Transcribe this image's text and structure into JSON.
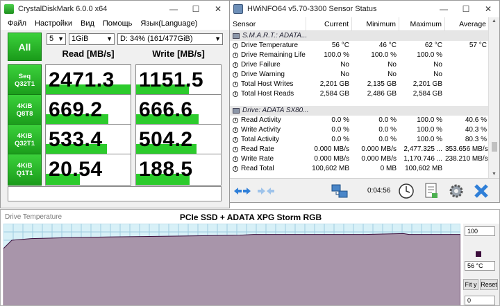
{
  "cdm": {
    "title": "CrystalDiskMark 6.0.0 x64",
    "menu": [
      "Файл",
      "Настройки",
      "Вид",
      "Помощь",
      "Язык(Language)"
    ],
    "all_label": "All",
    "count": "5",
    "size": "1GiB",
    "drive": "D: 34% (161/477GiB)",
    "read_header": "Read [MB/s]",
    "write_header": "Write [MB/s]",
    "rows": [
      {
        "line1": "Seq",
        "line2": "Q32T1",
        "read": "2471.3",
        "write": "1151.5",
        "read_fill": 1.0,
        "write_fill": 0.62
      },
      {
        "line1": "4KiB",
        "line2": "Q8T8",
        "read": "669.2",
        "write": "666.6",
        "read_fill": 0.74,
        "write_fill": 0.74
      },
      {
        "line1": "4KiB",
        "line2": "Q32T1",
        "read": "533.4",
        "write": "504.2",
        "read_fill": 0.72,
        "write_fill": 0.71
      },
      {
        "line1": "4KiB",
        "line2": "Q1T1",
        "read": "20.54",
        "write": "188.5",
        "read_fill": 0.4,
        "write_fill": 0.63
      }
    ]
  },
  "hw": {
    "title": "HWiNFO64 v5.70-3300 Sensor Status",
    "columns": [
      "Sensor",
      "Current",
      "Minimum",
      "Maximum",
      "Average"
    ],
    "groups": [
      {
        "name": "S.M.A.R.T.: ADATA...",
        "rows": [
          [
            "Drive Temperature",
            "56 °C",
            "46 °C",
            "62 °C",
            "57 °C"
          ],
          [
            "Drive Remaining Life",
            "100.0 %",
            "100.0 %",
            "100.0 %",
            ""
          ],
          [
            "Drive Failure",
            "No",
            "No",
            "No",
            ""
          ],
          [
            "Drive Warning",
            "No",
            "No",
            "No",
            ""
          ],
          [
            "Total Host Writes",
            "2,201 GB",
            "2,135 GB",
            "2,201 GB",
            ""
          ],
          [
            "Total Host Reads",
            "2,584 GB",
            "2,486 GB",
            "2,584 GB",
            ""
          ]
        ]
      },
      {
        "name": "Drive: ADATA SX80...",
        "rows": [
          [
            "Read Activity",
            "0.0 %",
            "0.0 %",
            "100.0 %",
            "40.6 %"
          ],
          [
            "Write Activity",
            "0.0 %",
            "0.0 %",
            "100.0 %",
            "40.3 %"
          ],
          [
            "Total Activity",
            "0.0 %",
            "0.0 %",
            "100.0 %",
            "80.3 %"
          ],
          [
            "Read Rate",
            "0.000 MB/s",
            "0.000 MB/s",
            "2,477.325 ...",
            "353.656 MB/s"
          ],
          [
            "Write Rate",
            "0.000 MB/s",
            "0.000 MB/s",
            "1,170.746 ...",
            "238.210 MB/s"
          ],
          [
            "Read Total",
            "100,602 MB",
            "0 MB",
            "100,602 MB",
            ""
          ]
        ]
      }
    ],
    "timer": "0:04:56"
  },
  "graph": {
    "label": "Drive Temperature",
    "title": "PCIe SSD + ADATA XPG Storm RGB",
    "max": "100",
    "current": "56 °C",
    "min": "0",
    "fit_label": "Fit y",
    "reset_label": "Reset"
  }
}
